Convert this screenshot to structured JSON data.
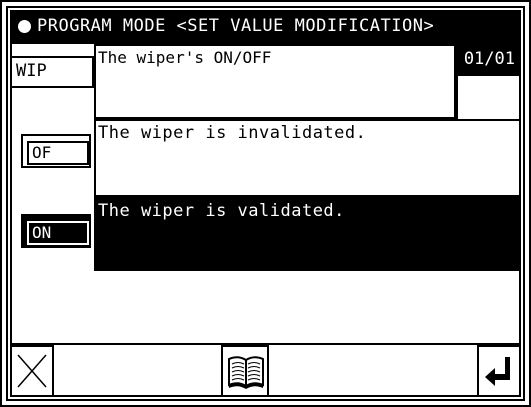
{
  "header": {
    "title": "PROGRAM MODE <SET VALUE MODIFICATION>"
  },
  "item": {
    "code": "WIP",
    "title": "The wiper's ON/OFF",
    "page": "01/01"
  },
  "options": [
    {
      "button_label": "OF",
      "description": "The wiper is invalidated.",
      "selected": false
    },
    {
      "button_label": "ON",
      "description": "The wiper is validated.",
      "selected": true
    }
  ],
  "footer": {
    "cancel_icon": "cross-icon",
    "manual_icon": "book-icon",
    "enter_icon": "enter-arrow-icon"
  },
  "colors": {
    "background": "#ffffff",
    "foreground": "#000000"
  }
}
